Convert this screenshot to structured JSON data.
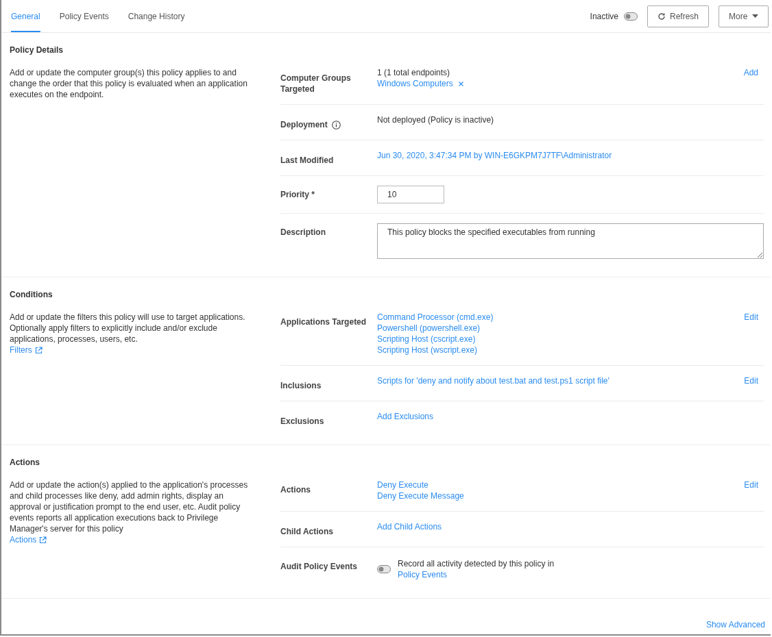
{
  "tabs": [
    {
      "label": "General",
      "selected": true
    },
    {
      "label": "Policy Events",
      "selected": false
    },
    {
      "label": "Change History",
      "selected": false
    }
  ],
  "status": {
    "label": "Inactive",
    "on": false
  },
  "buttons": [
    {
      "kind": "refresh",
      "label": "Refresh"
    },
    {
      "kind": "more",
      "label": "More"
    }
  ],
  "sections": [
    {
      "title": "Policy Details",
      "description": "Add or update the computer group(s) this policy applies to and change the order that this policy is evaluated when an application executes on the endpoint.",
      "fields": [
        {
          "kind": "groups",
          "label": "Computer Groups Targeted",
          "text": "1 (1 total endpoints)",
          "tags": [
            "Windows Computers"
          ],
          "action": "Add"
        },
        {
          "kind": "text",
          "label": "Deployment",
          "info": true,
          "value": "Not deployed (Policy is inactive)"
        },
        {
          "kind": "links",
          "label": "Last Modified",
          "links": [
            "Jun 30, 2020, 3:47:34 PM by WIN-E6GKPM7J7TF\\Administrator"
          ]
        },
        {
          "kind": "input",
          "label": "Priority *",
          "value": "10"
        },
        {
          "kind": "textarea",
          "label": "Description",
          "value": "This policy blocks the specified executables from running"
        }
      ]
    },
    {
      "title": "Conditions",
      "description": "Add or update the filters this policy will use to target applications. Optionally apply filters to explicitly include and/or exclude applications, processes, users, etc.",
      "link": "Filters",
      "fields": [
        {
          "kind": "links",
          "label": "Applications Targeted",
          "links": [
            "Command Processor (cmd.exe)",
            "Powershell (powershell.exe)",
            "Scripting Host (cscript.exe)",
            "Scripting Host (wscript.exe)"
          ],
          "action": "Edit"
        },
        {
          "kind": "links",
          "label": "Inclusions",
          "links": [
            "Scripts for 'deny and notify about test.bat and test.ps1 script file'"
          ],
          "action": "Edit"
        },
        {
          "kind": "links",
          "label": "Exclusions",
          "links": [
            "Add Exclusions"
          ]
        }
      ]
    },
    {
      "title": "Actions",
      "description": "Add or update the action(s) applied to the application's processes and child processes like deny, add admin rights, display an approval or justification prompt to the end user, etc. Audit policy events reports all application executions back to Privilege Manager's server for this policy",
      "link": "Actions",
      "fields": [
        {
          "kind": "links",
          "label": "Actions",
          "links": [
            "Deny Execute",
            "Deny Execute Message"
          ],
          "action": "Edit"
        },
        {
          "kind": "links",
          "label": "Child Actions",
          "links": [
            "Add Child Actions"
          ]
        },
        {
          "kind": "toggle",
          "label": "Audit Policy Events",
          "on": false,
          "text": "Record all activity detected by this policy in ",
          "link": "Policy Events"
        }
      ]
    }
  ],
  "show_advanced": "Show Advanced"
}
